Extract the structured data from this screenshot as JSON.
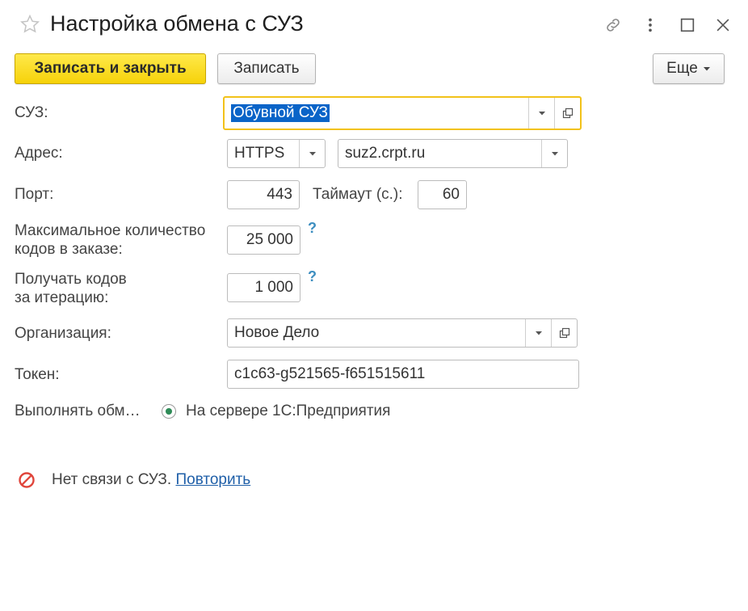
{
  "window": {
    "title": "Настройка обмена с СУЗ"
  },
  "toolbar": {
    "save_close_label": "Записать и закрыть",
    "save_label": "Записать",
    "more_label": "Еще"
  },
  "form": {
    "suz": {
      "label": "СУЗ:",
      "value": "Обувной СУЗ"
    },
    "address": {
      "label": "Адрес:",
      "protocol": "HTTPS",
      "host": "suz2.crpt.ru"
    },
    "port": {
      "label": "Порт:",
      "value": "443"
    },
    "timeout": {
      "label": "Таймаут (с.):",
      "value": "60"
    },
    "max_codes": {
      "label_line1": "Максимальное количество",
      "label_line2": "кодов в заказе:",
      "value": "25 000",
      "help": "?"
    },
    "per_iteration": {
      "label_line1": "Получать кодов",
      "label_line2": "за итерацию:",
      "value": "1 000",
      "help": "?"
    },
    "organization": {
      "label": "Организация:",
      "value": "Новое Дело"
    },
    "token": {
      "label": "Токен:",
      "value": "c1c63-g521565-f651515611"
    },
    "execute": {
      "label": "Выполнять обм…",
      "option": "На сервере 1С:Предприятия"
    }
  },
  "status": {
    "message": "Нет связи с СУЗ.",
    "retry_label": "Повторить"
  },
  "colors": {
    "primary_button": "#f6d20a",
    "focus_border": "#f2c21a",
    "selection": "#0a64c8",
    "help": "#3d8ec0",
    "error": "#e0463c",
    "link": "#1f5fa8"
  }
}
